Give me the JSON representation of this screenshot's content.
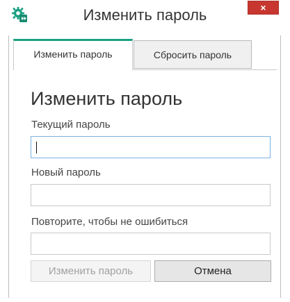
{
  "window": {
    "title": "Изменить пароль",
    "close_symbol": "×",
    "close_color": "#c7372f",
    "icon": "app-gear-icon"
  },
  "tabs": [
    {
      "label": "Изменить пароль",
      "active": true
    },
    {
      "label": "Сбросить пароль",
      "active": false
    }
  ],
  "accent_color": "#1aa183",
  "form": {
    "title": "Изменить пароль",
    "current_password": {
      "label": "Текущий пароль",
      "value": ""
    },
    "new_password": {
      "label": "Новый пароль",
      "value": ""
    },
    "repeat_password": {
      "label": "Повторите, чтобы не ошибиться",
      "value": ""
    }
  },
  "buttons": {
    "change_label": "Изменить пароль",
    "change_enabled": false,
    "cancel_label": "Отмена"
  }
}
